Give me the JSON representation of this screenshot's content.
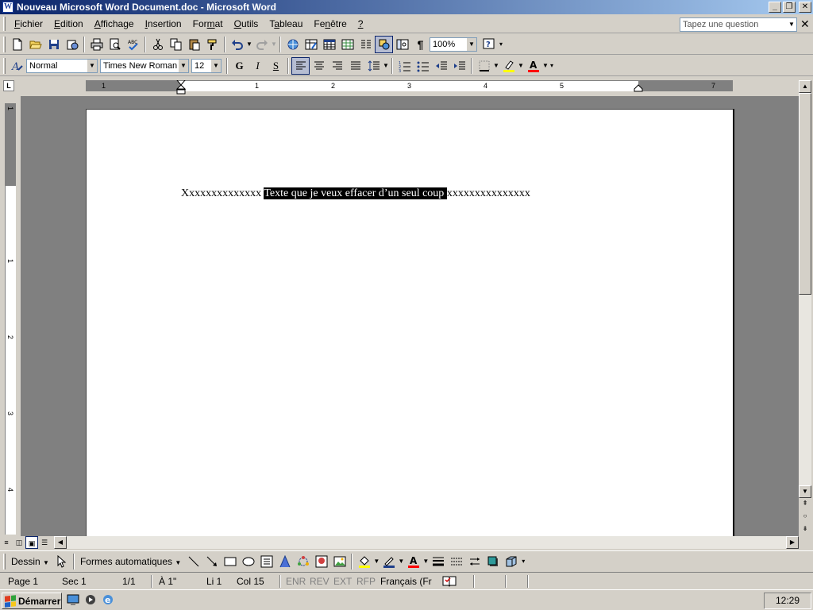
{
  "window": {
    "title": "Nouveau Microsoft Word Document.doc - Microsoft Word",
    "icon_letter": "W",
    "minimize": "_",
    "maximize": "❐",
    "close": "✕"
  },
  "menubar": {
    "items": [
      {
        "u": "F",
        "rest": "ichier"
      },
      {
        "u": "E",
        "rest": "dition"
      },
      {
        "u": "A",
        "rest": "ffichage"
      },
      {
        "u": "I",
        "rest": "nsertion"
      },
      {
        "u": "F",
        "rest": "ormat",
        "pre": ""
      },
      {
        "u": "O",
        "rest": "utils"
      },
      {
        "u": "T",
        "rest": "ableau"
      },
      {
        "u": "F",
        "rest": "enêtre",
        "pre": ""
      },
      {
        "u": "?",
        "rest": ""
      }
    ],
    "question_placeholder": "Tapez une question",
    "doc_close": "✕"
  },
  "standard_toolbar": {
    "zoom": "100%"
  },
  "formatting_toolbar": {
    "style": "Normal",
    "font": "Times New Roman",
    "size": "12",
    "bold": "G",
    "italic": "I",
    "strike": "S"
  },
  "ruler": {
    "corner": "L",
    "h_numbers": [
      "1",
      "1",
      "2",
      "3",
      "4",
      "5",
      "7"
    ],
    "v_numbers": [
      "1",
      "1",
      "2",
      "3",
      "4"
    ]
  },
  "document": {
    "before": "Xxxxxxxxxxxxxx ",
    "selected": "Texte que je veux effacer d’un seul coup ",
    "after": "xxxxxxxxxxxxxxx"
  },
  "drawing_toolbar": {
    "dessin": "Dessin",
    "autoshapes": "Formes automatiques"
  },
  "statusbar": {
    "page": "Page 1",
    "sec": "Sec 1",
    "pages": "1/1",
    "at": "À 1\"",
    "line": "Li 1",
    "col": "Col 15",
    "enr": "ENR",
    "rev": "REV",
    "ext": "EXT",
    "rfp": "RFP",
    "lang": "Français (Fr"
  },
  "taskbar": {
    "start": "Démarrer",
    "clock": "12:29"
  },
  "colors": {
    "title_start": "#0a246a",
    "title_end": "#a6caf0",
    "face": "#d4d0c8",
    "selection": "#000000",
    "highlight": "#ffff00",
    "font_color": "#ff0000"
  }
}
